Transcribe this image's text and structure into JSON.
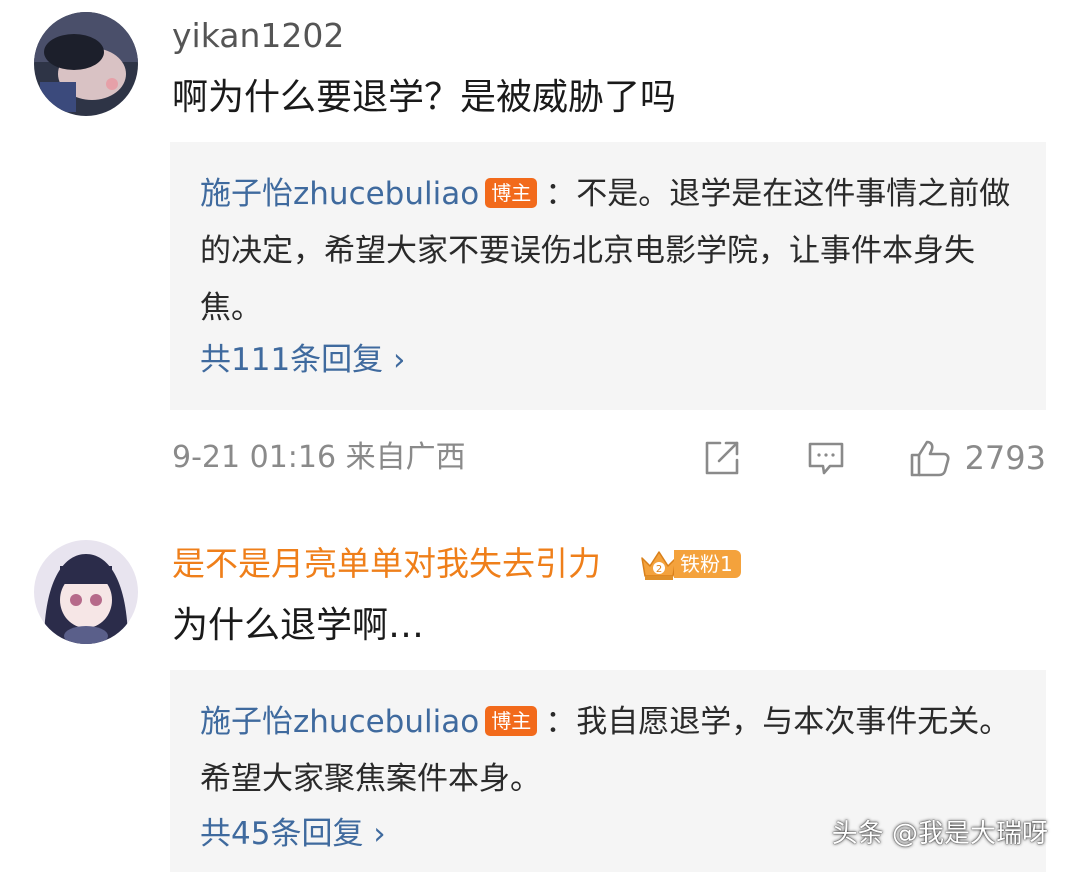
{
  "comments": [
    {
      "username": "yikan1202",
      "text": "啊为什么要退学？是被威胁了吗",
      "reply": {
        "author": "施子怡zhucebuliao",
        "badge": "博主",
        "text": "：不是。退学是在这件事情之前做的决定，希望大家不要误伤北京电影学院，让事件本身失焦。",
        "more": "共111条回复 ›"
      },
      "time": "9-21 01:16  来自广西",
      "likes": "2793"
    },
    {
      "username": "是不是月亮单单对我失去引力",
      "fan_badge": "铁粉1",
      "text": "为什么退学啊…",
      "reply": {
        "author": "施子怡zhucebuliao",
        "badge": "博主",
        "text": "：我自愿退学，与本次事件无关。希望大家聚焦案件本身。",
        "more": "共45条回复 ›"
      }
    }
  ],
  "icons": {
    "share": "share-icon",
    "comment": "comment-icon",
    "like": "thumbs-up-icon"
  },
  "colors": {
    "link_blue": "#3f6a9e",
    "vip_orange": "#ef7f1a",
    "blogger_badge": "#f26a1b",
    "reply_bg": "#f5f5f5",
    "meta_gray": "#8a8a8a"
  },
  "watermark": "头条 @我是大瑞呀"
}
